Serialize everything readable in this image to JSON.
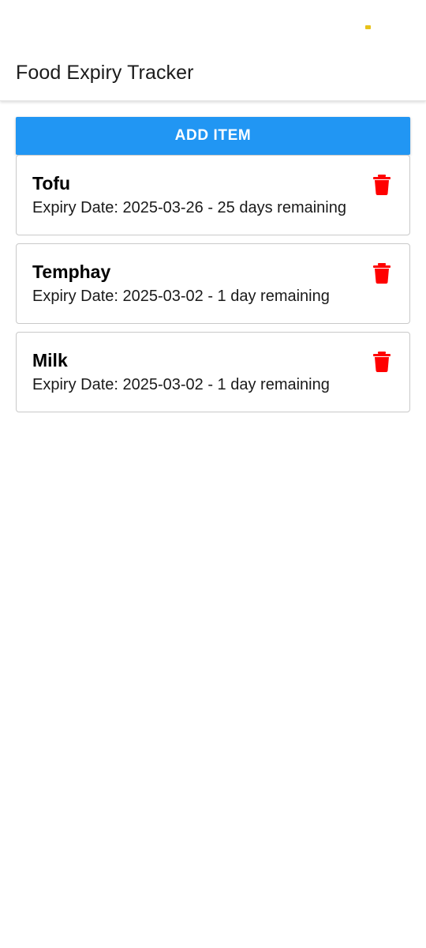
{
  "app": {
    "title": "Food Expiry Tracker"
  },
  "toolbar": {
    "add_label": "ADD ITEM"
  },
  "colors": {
    "accent": "#2196f3",
    "delete": "#ff0000",
    "status_dot": "#e8c21a"
  },
  "items": [
    {
      "name": "Tofu",
      "expiry": "Expiry Date: 2025-03-26 - 25 days remaining",
      "delete_icon": "trash-icon"
    },
    {
      "name": "Temphay",
      "expiry": "Expiry Date: 2025-03-02 - 1 day remaining",
      "delete_icon": "trash-icon"
    },
    {
      "name": "Milk",
      "expiry": "Expiry Date: 2025-03-02 - 1 day remaining",
      "delete_icon": "trash-icon"
    }
  ]
}
